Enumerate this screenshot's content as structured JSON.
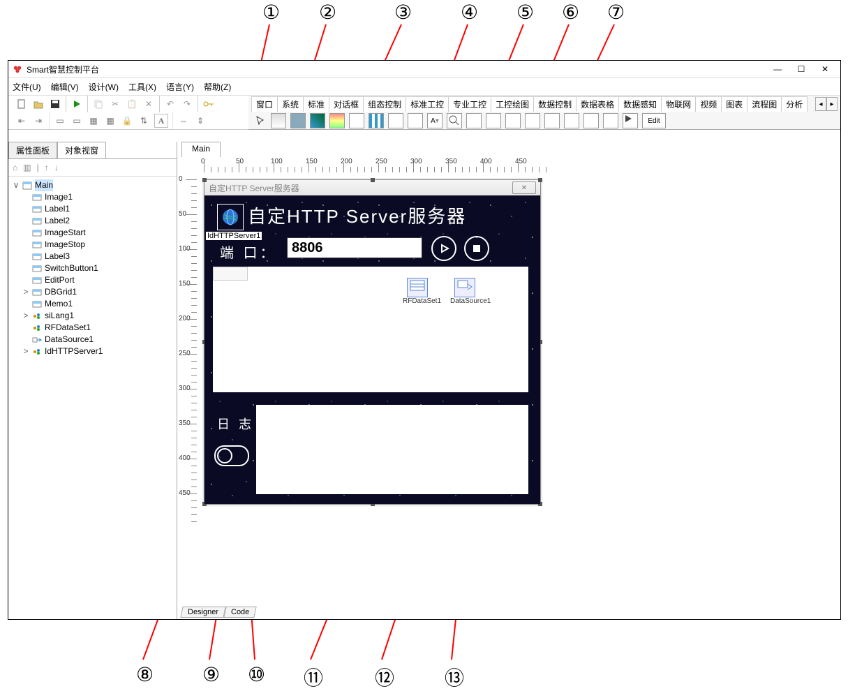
{
  "window": {
    "title": "Smart智慧控制平台",
    "min": "—",
    "max": "☐",
    "close": "✕"
  },
  "menu": [
    "文件(U)",
    "编辑(V)",
    "设计(W)",
    "工具(X)",
    "语言(Y)",
    "帮助(Z)"
  ],
  "component_tabs": [
    "窗口",
    "系统",
    "标准",
    "对话框",
    "组态控制",
    "标准工控",
    "专业工控",
    "工控绘图",
    "数据控制",
    "数据表格",
    "数据感知",
    "物联网",
    "视频",
    "图表",
    "流程图",
    "分析"
  ],
  "component_spin": {
    "left": "◂",
    "right": "▸",
    "sep": "|"
  },
  "left_panel": {
    "tabs": [
      "属性面板",
      "对象视窗"
    ],
    "active": 1,
    "toolbar_icons": [
      "⌂",
      "▥",
      "|",
      "↑",
      "↓"
    ],
    "tree": {
      "root": "Main",
      "children": [
        {
          "label": "Image1",
          "kind": "rect"
        },
        {
          "label": "Label1",
          "kind": "rect"
        },
        {
          "label": "Label2",
          "kind": "rect"
        },
        {
          "label": "ImageStart",
          "kind": "rect"
        },
        {
          "label": "ImageStop",
          "kind": "rect"
        },
        {
          "label": "Label3",
          "kind": "rect"
        },
        {
          "label": "SwitchButton1",
          "kind": "rect"
        },
        {
          "label": "EditPort",
          "kind": "rect"
        },
        {
          "label": "DBGrid1",
          "kind": "rect",
          "exp": ">"
        },
        {
          "label": "Memo1",
          "kind": "rect"
        },
        {
          "label": "siLang1",
          "kind": "dot",
          "exp": ">"
        },
        {
          "label": "RFDataSet1",
          "kind": "dot"
        },
        {
          "label": "DataSource1",
          "kind": "link"
        },
        {
          "label": "IdHTTPServer1",
          "kind": "dot",
          "exp": ">"
        }
      ]
    }
  },
  "center": {
    "top_tab": "Main",
    "bottom_tabs": [
      "Designer",
      "Code"
    ],
    "ruler_h": [
      "0",
      "50",
      "100",
      "150",
      "200",
      "250",
      "300",
      "350",
      "400",
      "450"
    ],
    "ruler_v": [
      "0",
      "50",
      "100",
      "150",
      "200",
      "250",
      "300",
      "350",
      "400",
      "450"
    ]
  },
  "form": {
    "title": "自定HTTP Server服务器",
    "close": "✕",
    "id_label": "IdHTTPServer1",
    "heading": "自定HTTP Server服务器",
    "port_label": "端 口：",
    "port_value": "8806",
    "play_icon": "▷",
    "stop_icon": "■",
    "rfdataset": "RFDataSet1",
    "datasource": "DataSource1",
    "log_label": "日 志",
    "edit_btn": "Edit"
  },
  "annotations": {
    "top": [
      "①",
      "②",
      "③",
      "④",
      "⑤",
      "⑥",
      "⑦"
    ],
    "bottom": [
      "⑧",
      "⑨",
      "⑩",
      "⑪",
      "⑫",
      "⑬"
    ]
  }
}
